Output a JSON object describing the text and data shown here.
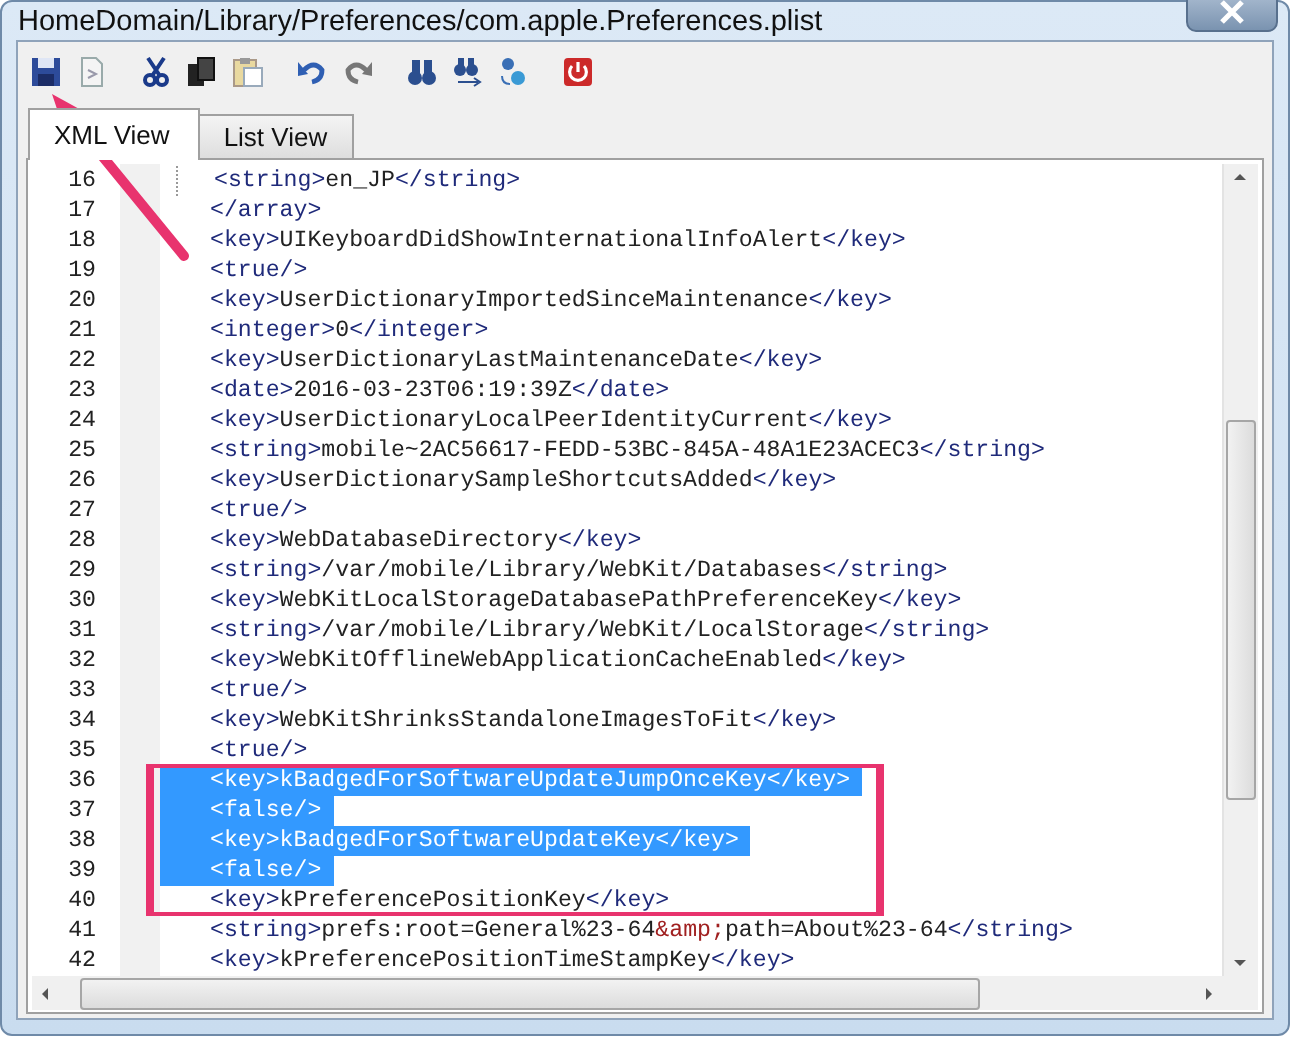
{
  "window": {
    "title": "HomeDomain/Library/Preferences/com.apple.Preferences.plist"
  },
  "toolbar": [
    {
      "kind": "save"
    },
    {
      "kind": "document"
    },
    {
      "kind": "cut"
    },
    {
      "kind": "copy"
    },
    {
      "kind": "paste"
    },
    {
      "kind": "undo"
    },
    {
      "kind": "redo"
    },
    {
      "kind": "find"
    },
    {
      "kind": "find-next"
    },
    {
      "kind": "replace"
    },
    {
      "kind": "power"
    }
  ],
  "tabs": [
    {
      "label": "XML View",
      "selected": true
    },
    {
      "label": "List View",
      "selected": false
    }
  ],
  "editor": {
    "lines": [
      {
        "number": "16",
        "text": "<string>en_JP</string>",
        "indented": true,
        "selected": false
      },
      {
        "number": "17",
        "text": "</array>",
        "indented": false,
        "selected": false
      },
      {
        "number": "18",
        "text": "<key>UIKeyboardDidShowInternationalInfoAlert</key>",
        "indented": false,
        "selected": false
      },
      {
        "number": "19",
        "text": "<true/>",
        "indented": false,
        "selected": false
      },
      {
        "number": "20",
        "text": "<key>UserDictionaryImportedSinceMaintenance</key>",
        "indented": false,
        "selected": false
      },
      {
        "number": "21",
        "text": "<integer>0</integer>",
        "indented": false,
        "selected": false
      },
      {
        "number": "22",
        "text": "<key>UserDictionaryLastMaintenanceDate</key>",
        "indented": false,
        "selected": false
      },
      {
        "number": "23",
        "text": "<date>2016-03-23T06:19:39Z</date>",
        "indented": false,
        "selected": false
      },
      {
        "number": "24",
        "text": "<key>UserDictionaryLocalPeerIdentityCurrent</key>",
        "indented": false,
        "selected": false
      },
      {
        "number": "25",
        "text": "<string>mobile~2AC56617-FEDD-53BC-845A-48A1E23ACEC3</string>",
        "indented": false,
        "selected": false
      },
      {
        "number": "26",
        "text": "<key>UserDictionarySampleShortcutsAdded</key>",
        "indented": false,
        "selected": false
      },
      {
        "number": "27",
        "text": "<true/>",
        "indented": false,
        "selected": false
      },
      {
        "number": "28",
        "text": "<key>WebDatabaseDirectory</key>",
        "indented": false,
        "selected": false
      },
      {
        "number": "29",
        "text": "<string>/var/mobile/Library/WebKit/Databases</string>",
        "indented": false,
        "selected": false
      },
      {
        "number": "30",
        "text": "<key>WebKitLocalStorageDatabasePathPreferenceKey</key>",
        "indented": false,
        "selected": false
      },
      {
        "number": "31",
        "text": "<string>/var/mobile/Library/WebKit/LocalStorage</string>",
        "indented": false,
        "selected": false
      },
      {
        "number": "32",
        "text": "<key>WebKitOfflineWebApplicationCacheEnabled</key>",
        "indented": false,
        "selected": false
      },
      {
        "number": "33",
        "text": "<true/>",
        "indented": false,
        "selected": false
      },
      {
        "number": "34",
        "text": "<key>WebKitShrinksStandaloneImagesToFit</key>",
        "indented": false,
        "selected": false
      },
      {
        "number": "35",
        "text": "<true/>",
        "indented": false,
        "selected": false
      },
      {
        "number": "36",
        "text": "<key>kBadgedForSoftwareUpdateJumpOnceKey</key>",
        "indented": false,
        "selected": true
      },
      {
        "number": "37",
        "text": "<false/>",
        "indented": false,
        "selected": true
      },
      {
        "number": "38",
        "text": "<key>kBadgedForSoftwareUpdateKey</key>",
        "indented": false,
        "selected": true
      },
      {
        "number": "39",
        "text": "<false/>",
        "indented": false,
        "selected": true
      },
      {
        "number": "40",
        "text": "<key>kPreferencePositionKey</key>",
        "indented": false,
        "selected": false
      },
      {
        "number": "41",
        "text": "<string>prefs:root=General%23-64&amp;path=About%23-64</string>",
        "indented": false,
        "selected": false
      },
      {
        "number": "42",
        "text": "<key>kPreferencePositionTimeStampKey</key>",
        "indented": false,
        "selected": false
      }
    ]
  },
  "annotations": {
    "arrow": true,
    "highlight_frame": true
  }
}
